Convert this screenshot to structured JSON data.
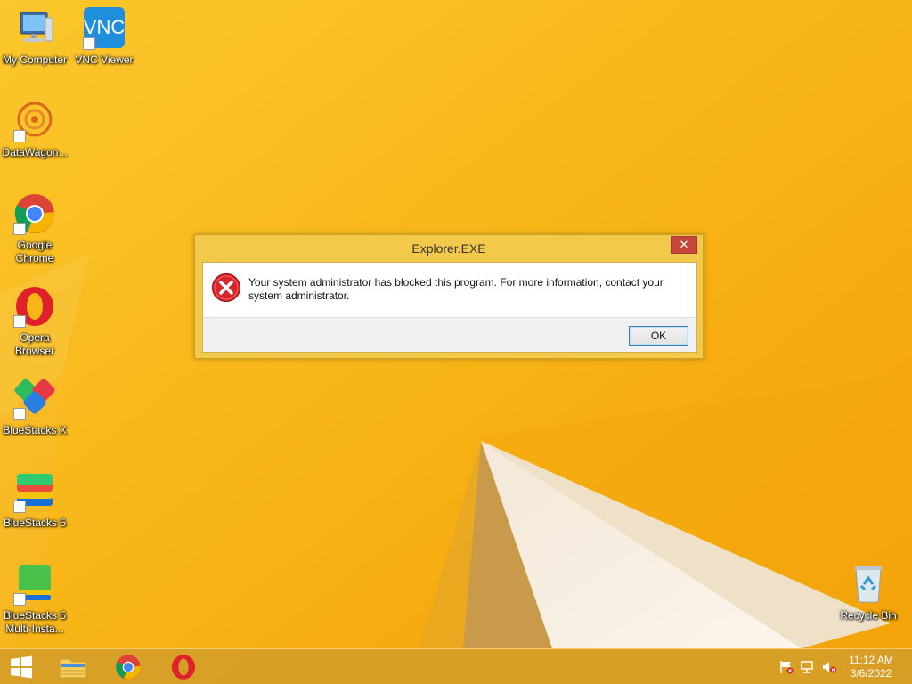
{
  "desktop": {
    "icons": [
      {
        "label": "My Computer"
      },
      {
        "label": "VNC Viewer"
      },
      {
        "label": "DataWagon..."
      },
      {
        "label": "Google Chrome"
      },
      {
        "label": "Opera Browser"
      },
      {
        "label": "BlueStacks X"
      },
      {
        "label": "BlueStacks 5"
      },
      {
        "label": "BlueStacks 5 Multi-Insta..."
      },
      {
        "label": "Recycle Bin"
      }
    ]
  },
  "dialog": {
    "title": "Explorer.EXE",
    "close_icon": "close-icon",
    "message": "Your system administrator has blocked this program. For more information, contact your system administrator.",
    "ok_label": "OK",
    "icon": "error-icon"
  },
  "taskbar": {
    "pinned": [
      "File Explorer",
      "Google Chrome",
      "Opera"
    ],
    "tray_icons": [
      "action-center-flag-icon",
      "network-icon",
      "volume-muted-icon"
    ],
    "clock": {
      "time": "11:12 AM",
      "date": "3/6/2022"
    }
  },
  "colors": {
    "wallpaper": "#f7b516",
    "close_button": "#c7463a",
    "error_red": "#d8262b"
  }
}
